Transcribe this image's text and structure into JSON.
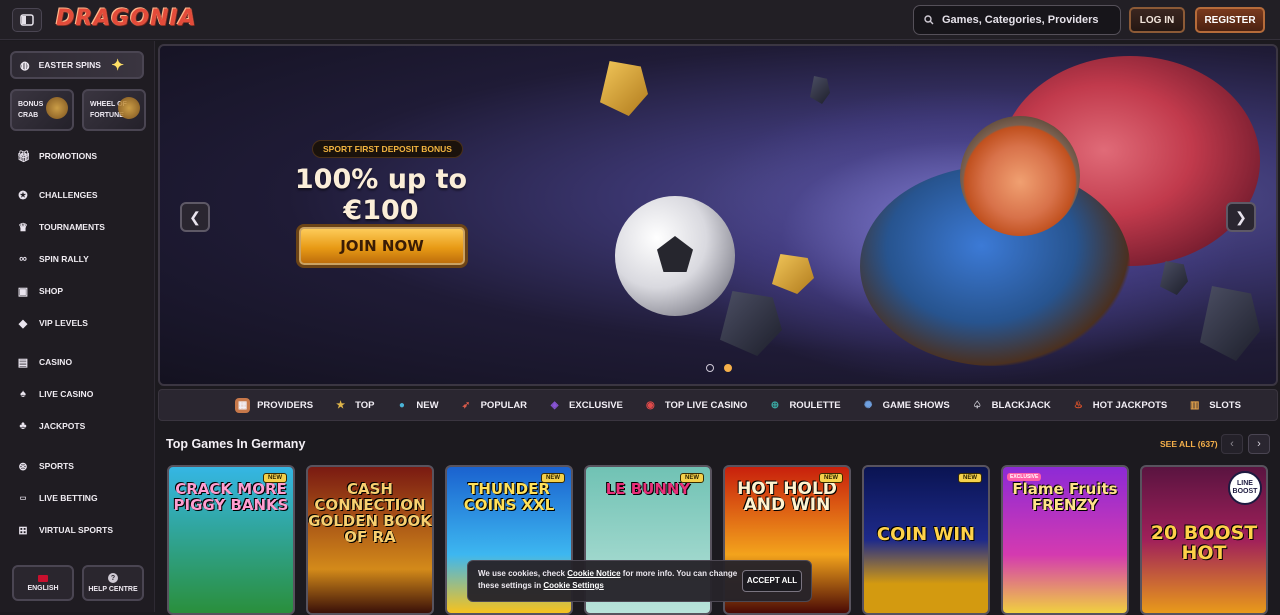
{
  "header": {
    "logo_text": "DRAGONIA",
    "search_placeholder": "Games, Categories, Providers",
    "login_label": "LOG IN",
    "register_label": "REGISTER"
  },
  "sidebar": {
    "promo_pill": "EASTER SPINS",
    "tiles": [
      {
        "label_line1": "BONUS",
        "label_line2": "CRAB"
      },
      {
        "label_line1": "WHEEL OF",
        "label_line2": "FORTUNE"
      }
    ],
    "items": [
      {
        "label": "PROMOTIONS",
        "icon": "gift-icon"
      },
      {
        "label": "CHALLENGES",
        "icon": "medal-icon"
      },
      {
        "label": "TOURNAMENTS",
        "icon": "trophy-icon"
      },
      {
        "label": "SPIN RALLY",
        "icon": "rally-icon"
      },
      {
        "label": "SHOP",
        "icon": "shop-bag-icon"
      },
      {
        "label": "VIP LEVELS",
        "icon": "diamond-icon"
      },
      {
        "label": "CASINO",
        "icon": "slot-machine-icon"
      },
      {
        "label": "LIVE CASINO",
        "icon": "cards-icon"
      },
      {
        "label": "JACKPOTS",
        "icon": "clover-icon"
      },
      {
        "label": "SPORTS",
        "icon": "ball-icon"
      },
      {
        "label": "LIVE BETTING",
        "icon": "live-icon"
      },
      {
        "label": "VIRTUAL SPORTS",
        "icon": "controller-icon"
      }
    ],
    "language_label": "ENGLISH",
    "help_label": "HELP CENTRE"
  },
  "hero": {
    "tag": "SPORT FIRST DEPOSIT BONUS",
    "title": "100% up to €100",
    "cta_label": "JOIN NOW",
    "slides_total": 2,
    "active_slide": 2
  },
  "categories": [
    {
      "label": "PROVIDERS",
      "icon": "providers-icon",
      "color": "#c7784a"
    },
    {
      "label": "TOP",
      "icon": "star-icon",
      "color": "#e0b64a"
    },
    {
      "label": "NEW",
      "icon": "gem-icon",
      "color": "#4ab3d6"
    },
    {
      "label": "POPULAR",
      "icon": "rocket-icon",
      "color": "#d85a4a"
    },
    {
      "label": "EXCLUSIVE",
      "icon": "crystal-icon",
      "color": "#8a55d8"
    },
    {
      "label": "TOP LIVE CASINO",
      "icon": "chip-icon",
      "color": "#e04a4a"
    },
    {
      "label": "ROULETTE",
      "icon": "roulette-icon",
      "color": "#3aa6a0"
    },
    {
      "label": "GAME SHOWS",
      "icon": "wheel-icon",
      "color": "#6fa0e0"
    },
    {
      "label": "BLACKJACK",
      "icon": "blackjack-icon",
      "color": "#d8d8e0"
    },
    {
      "label": "HOT JACKPOTS",
      "icon": "flame-icon",
      "color": "#e8552a"
    },
    {
      "label": "SLOTS",
      "icon": "slots-icon",
      "color": "#e0a04a"
    }
  ],
  "top_games": {
    "title": "Top Games In Germany",
    "see_all": "SEE ALL (637)",
    "games": [
      {
        "name": "CRACK MORE PIGGY BANKS",
        "badge": "NEW",
        "bg": "#2aa6d8"
      },
      {
        "name": "CASH CONNECTION GOLDEN BOOK OF RA",
        "badge": "",
        "bg": "#6a1812"
      },
      {
        "name": "THUNDER COINS XXL",
        "badge": "NEW",
        "bg": "#1d5fc8"
      },
      {
        "name": "LE BUNNY",
        "badge": "NEW",
        "bg": "#5fb3a8"
      },
      {
        "name": "HOT HOLD AND WIN",
        "badge": "NEW",
        "bg": "#b31c0c"
      },
      {
        "name": "COIN WIN",
        "badge": "NEW",
        "bg": "#0c1656"
      },
      {
        "name": "Flame Fruits FRENZY",
        "badge": "EXCLUSIVE",
        "bg": "#7a1fb0"
      },
      {
        "name": "20 BOOST HOT",
        "badge": "LINE BOOST",
        "bg": "#4a1236"
      }
    ]
  },
  "cookie": {
    "text_a": "We use cookies, check ",
    "link_a": "Cookie Notice",
    "text_b": " for more info. You can change",
    "text_c": "these settings in ",
    "link_b": "Cookie Settings",
    "accept_label": "ACCEPT ALL"
  }
}
